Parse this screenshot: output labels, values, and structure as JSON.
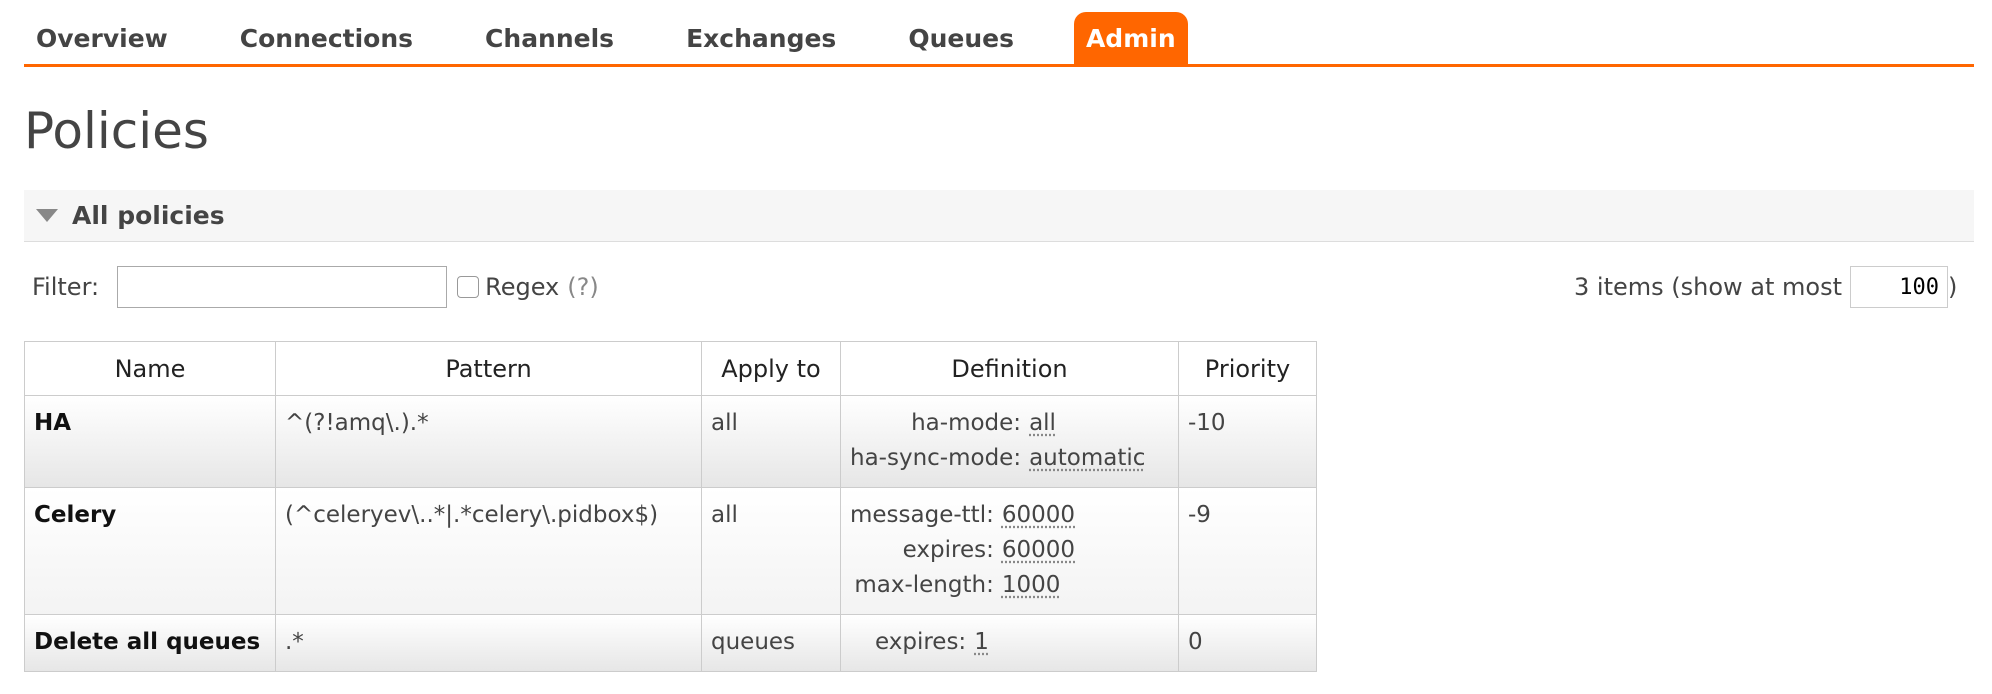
{
  "nav": {
    "tabs": [
      {
        "label": "Overview"
      },
      {
        "label": "Connections"
      },
      {
        "label": "Channels"
      },
      {
        "label": "Exchanges"
      },
      {
        "label": "Queues"
      },
      {
        "label": "Admin",
        "active": true
      }
    ]
  },
  "page": {
    "title": "Policies"
  },
  "section": {
    "label": "All policies"
  },
  "filter": {
    "label": "Filter:",
    "value": "",
    "regex_label": "Regex",
    "regex_help": "(?)",
    "regex_checked": false
  },
  "paging": {
    "prefix": "3 items (show at most",
    "page_size": "100",
    "suffix": ")"
  },
  "table": {
    "headers": {
      "name": "Name",
      "pattern": "Pattern",
      "apply_to": "Apply to",
      "definition": "Definition",
      "priority": "Priority"
    },
    "rows": [
      {
        "name": "HA",
        "pattern": "^(?!amq\\.).*",
        "apply_to": "all",
        "definition": [
          {
            "key": "ha-mode:",
            "value": "all"
          },
          {
            "key": "ha-sync-mode:",
            "value": "automatic"
          }
        ],
        "priority": "-10"
      },
      {
        "name": "Celery",
        "pattern": "(^celeryev\\..*|.*celery\\.pidbox$)",
        "apply_to": "all",
        "definition": [
          {
            "key": "message-ttl:",
            "value": "60000"
          },
          {
            "key": "expires:",
            "value": "60000"
          },
          {
            "key": "max-length:",
            "value": "1000"
          }
        ],
        "priority": "-9"
      },
      {
        "name": "Delete all queues",
        "pattern": ".*",
        "apply_to": "queues",
        "definition": [
          {
            "key": "expires:",
            "value": "1"
          }
        ],
        "priority": "0"
      }
    ]
  },
  "colors": {
    "accent": "#ff6600",
    "text": "#444444",
    "border": "#cccccc"
  },
  "icons": {
    "section_toggle": "triangle-down-icon"
  }
}
